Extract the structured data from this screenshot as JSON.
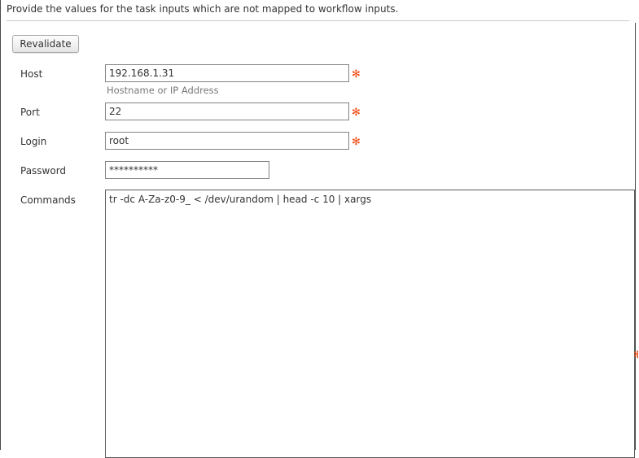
{
  "page": {
    "intro": "Provide the values for the task inputs which are not mapped to workflow inputs.",
    "required_marker": "✻",
    "accent_color": "#f0470c"
  },
  "toolbar": {
    "revalidate_label": "Revalidate"
  },
  "form": {
    "fields": [
      {
        "label": "Host",
        "value": "192.168.1.31",
        "placeholder": "",
        "hint": "Hostname or IP Address",
        "required": true,
        "type": "text"
      },
      {
        "label": "Port",
        "value": "22",
        "placeholder": "",
        "hint": "",
        "required": true,
        "type": "text"
      },
      {
        "label": "Login",
        "value": "root",
        "placeholder": "",
        "hint": "",
        "required": true,
        "type": "text"
      },
      {
        "label": "Password",
        "value": "**********",
        "placeholder": "",
        "hint": "",
        "required": false,
        "type": "password"
      },
      {
        "label": "Commands",
        "value": "tr -dc A-Za-z0-9_ < /dev/urandom | head -c 10 | xargs",
        "placeholder": "",
        "hint": "",
        "required": true,
        "type": "textarea"
      }
    ]
  }
}
